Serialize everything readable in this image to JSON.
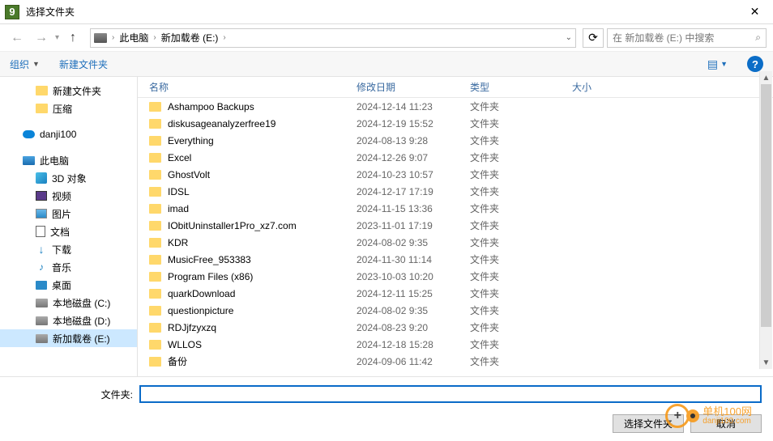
{
  "title": "选择文件夹",
  "breadcrumb": {
    "root": "此电脑",
    "current": "新加载卷 (E:)"
  },
  "search_placeholder": "在 新加载卷 (E:) 中搜索",
  "toolbar": {
    "organize": "组织",
    "new_folder": "新建文件夹"
  },
  "columns": {
    "name": "名称",
    "date": "修改日期",
    "type": "类型",
    "size": "大小"
  },
  "sidebar": {
    "new_folder": "新建文件夹",
    "zip": "压缩",
    "cloud": "danji100",
    "pc": "此电脑",
    "obj3d": "3D 对象",
    "video": "视频",
    "pics": "图片",
    "docs": "文档",
    "downloads": "下载",
    "music": "音乐",
    "desktop": "桌面",
    "drive_c": "本地磁盘 (C:)",
    "drive_d": "本地磁盘 (D:)",
    "drive_e": "新加载卷 (E:)"
  },
  "type_folder": "文件夹",
  "files": [
    {
      "name": "Ashampoo Backups",
      "date": "2024-12-14 11:23"
    },
    {
      "name": "diskusageanalyzerfree19",
      "date": "2024-12-19 15:52"
    },
    {
      "name": "Everything",
      "date": "2024-08-13 9:28"
    },
    {
      "name": "Excel",
      "date": "2024-12-26 9:07"
    },
    {
      "name": "GhostVolt",
      "date": "2024-10-23 10:57"
    },
    {
      "name": "IDSL",
      "date": "2024-12-17 17:19"
    },
    {
      "name": "imad",
      "date": "2024-11-15 13:36"
    },
    {
      "name": "IObitUninstaller1Pro_xz7.com",
      "date": "2023-11-01 17:19"
    },
    {
      "name": "KDR",
      "date": "2024-08-02 9:35"
    },
    {
      "name": "MusicFree_953383",
      "date": "2024-11-30 11:14"
    },
    {
      "name": "Program Files (x86)",
      "date": "2023-10-03 10:20"
    },
    {
      "name": "quarkDownload",
      "date": "2024-12-11 15:25"
    },
    {
      "name": "questionpicture",
      "date": "2024-08-02 9:35"
    },
    {
      "name": "RDJjfzyxzq",
      "date": "2024-08-23 9:20"
    },
    {
      "name": "WLLOS",
      "date": "2024-12-18 15:28"
    },
    {
      "name": "备份",
      "date": "2024-09-06 11:42"
    }
  ],
  "footer": {
    "label": "文件夹:",
    "select": "选择文件夹",
    "cancel": "取消"
  },
  "watermark": {
    "brand": "单机100网",
    "url": "danji100.com"
  }
}
